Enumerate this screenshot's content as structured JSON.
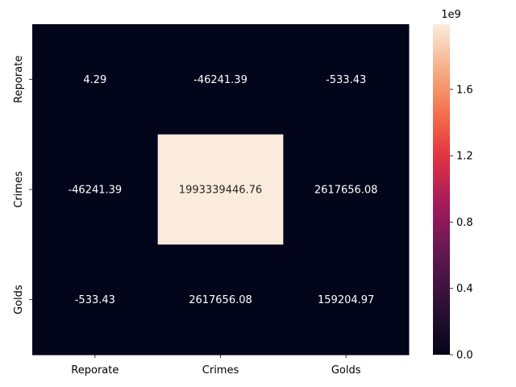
{
  "chart_data": {
    "type": "heatmap",
    "title": "",
    "xlabel": "",
    "ylabel": "",
    "x_categories": [
      "Reporate",
      "Crimes",
      "Golds"
    ],
    "y_categories": [
      "Reporate",
      "Crimes",
      "Golds"
    ],
    "values": [
      [
        4.29,
        -46241.39,
        -533.43
      ],
      [
        -46241.39,
        1993339446.76,
        2617656.08
      ],
      [
        -533.43,
        2617656.08,
        159204.97
      ]
    ],
    "cell_labels": [
      [
        "4.29",
        "-46241.39",
        "-533.43"
      ],
      [
        "-46241.39",
        "1993339446.76",
        "2617656.08"
      ],
      [
        "-533.43",
        "2617656.08",
        "159204.97"
      ]
    ],
    "colorbar": {
      "range": [
        0,
        1993339446.76
      ],
      "ticks": [
        "0.0",
        "0.4",
        "0.8",
        "1.2",
        "1.6"
      ],
      "tick_values": [
        0,
        400000000.0,
        800000000.0,
        1200000000.0,
        1600000000.0
      ],
      "multiplier_label": "1e9",
      "colormap": "rocket"
    },
    "grid": false
  }
}
